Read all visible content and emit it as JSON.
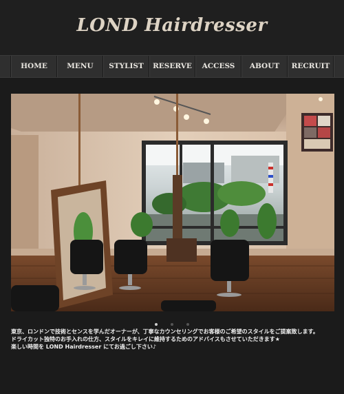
{
  "site": {
    "title": "LOND Hairdresser"
  },
  "nav": {
    "items": [
      {
        "label": "HOME"
      },
      {
        "label": "MENU"
      },
      {
        "label": "STYLIST"
      },
      {
        "label": "RESERVE"
      },
      {
        "label": "ACCESS"
      },
      {
        "label": "ABOUT"
      },
      {
        "label": "RECRUIT"
      }
    ]
  },
  "slider": {
    "image": "salon-interior-photo",
    "slides": 3,
    "active_slide": 1
  },
  "intro": {
    "lines": [
      "東京、ロンドンで技術とセンスを学んだオーナーが、丁寧なカウンセリングでお客様のご希望のスタイルをご提案致します。",
      "ドライカット独特のお手入れの仕方、スタイルをキレイに維持するためのアドバイスもさせていただきます★",
      "楽しい時間を LOND Hairdresser にてお過ごし下さい♪"
    ]
  },
  "colors": {
    "background": "#1b1b1b",
    "nav_background": "#2f2f2f",
    "title_color": "#ddd3c4",
    "text_color": "#f1f1f1"
  }
}
